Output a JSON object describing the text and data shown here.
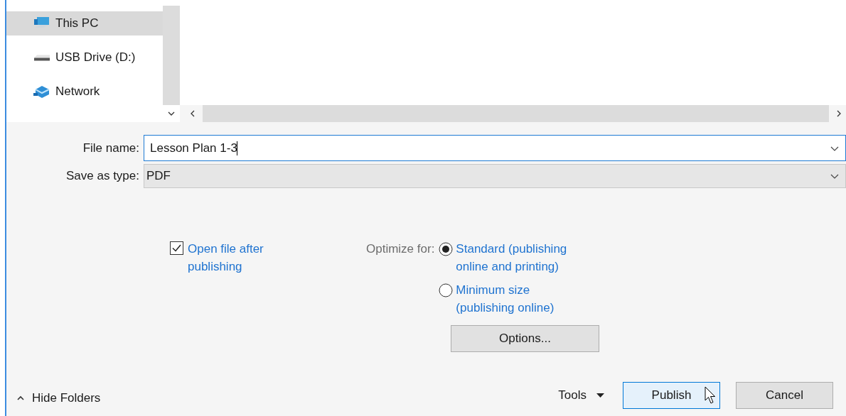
{
  "nav_pane": {
    "items": [
      {
        "label": "This PC",
        "kind": "computer",
        "selected": true
      },
      {
        "label": "USB Drive (D:)",
        "kind": "drive",
        "selected": false
      },
      {
        "label": "Network",
        "kind": "network",
        "selected": false
      }
    ]
  },
  "file_name": {
    "label": "File name:",
    "value": "Lesson Plan 1-3"
  },
  "save_as_type": {
    "label": "Save as type:",
    "value": "PDF"
  },
  "open_after": {
    "label": "Open file after publishing",
    "checked": true
  },
  "optimize": {
    "label": "Optimize for:",
    "options": [
      {
        "label": "Standard (publishing online and printing)",
        "selected": true
      },
      {
        "label": "Minimum size (publishing online)",
        "selected": false
      }
    ]
  },
  "options_button": "Options...",
  "hide_folders": "Hide Folders",
  "tools": "Tools",
  "buttons": [
    {
      "label": "Publish",
      "highlighted": true
    },
    {
      "label": "Cancel",
      "highlighted": false
    }
  ]
}
